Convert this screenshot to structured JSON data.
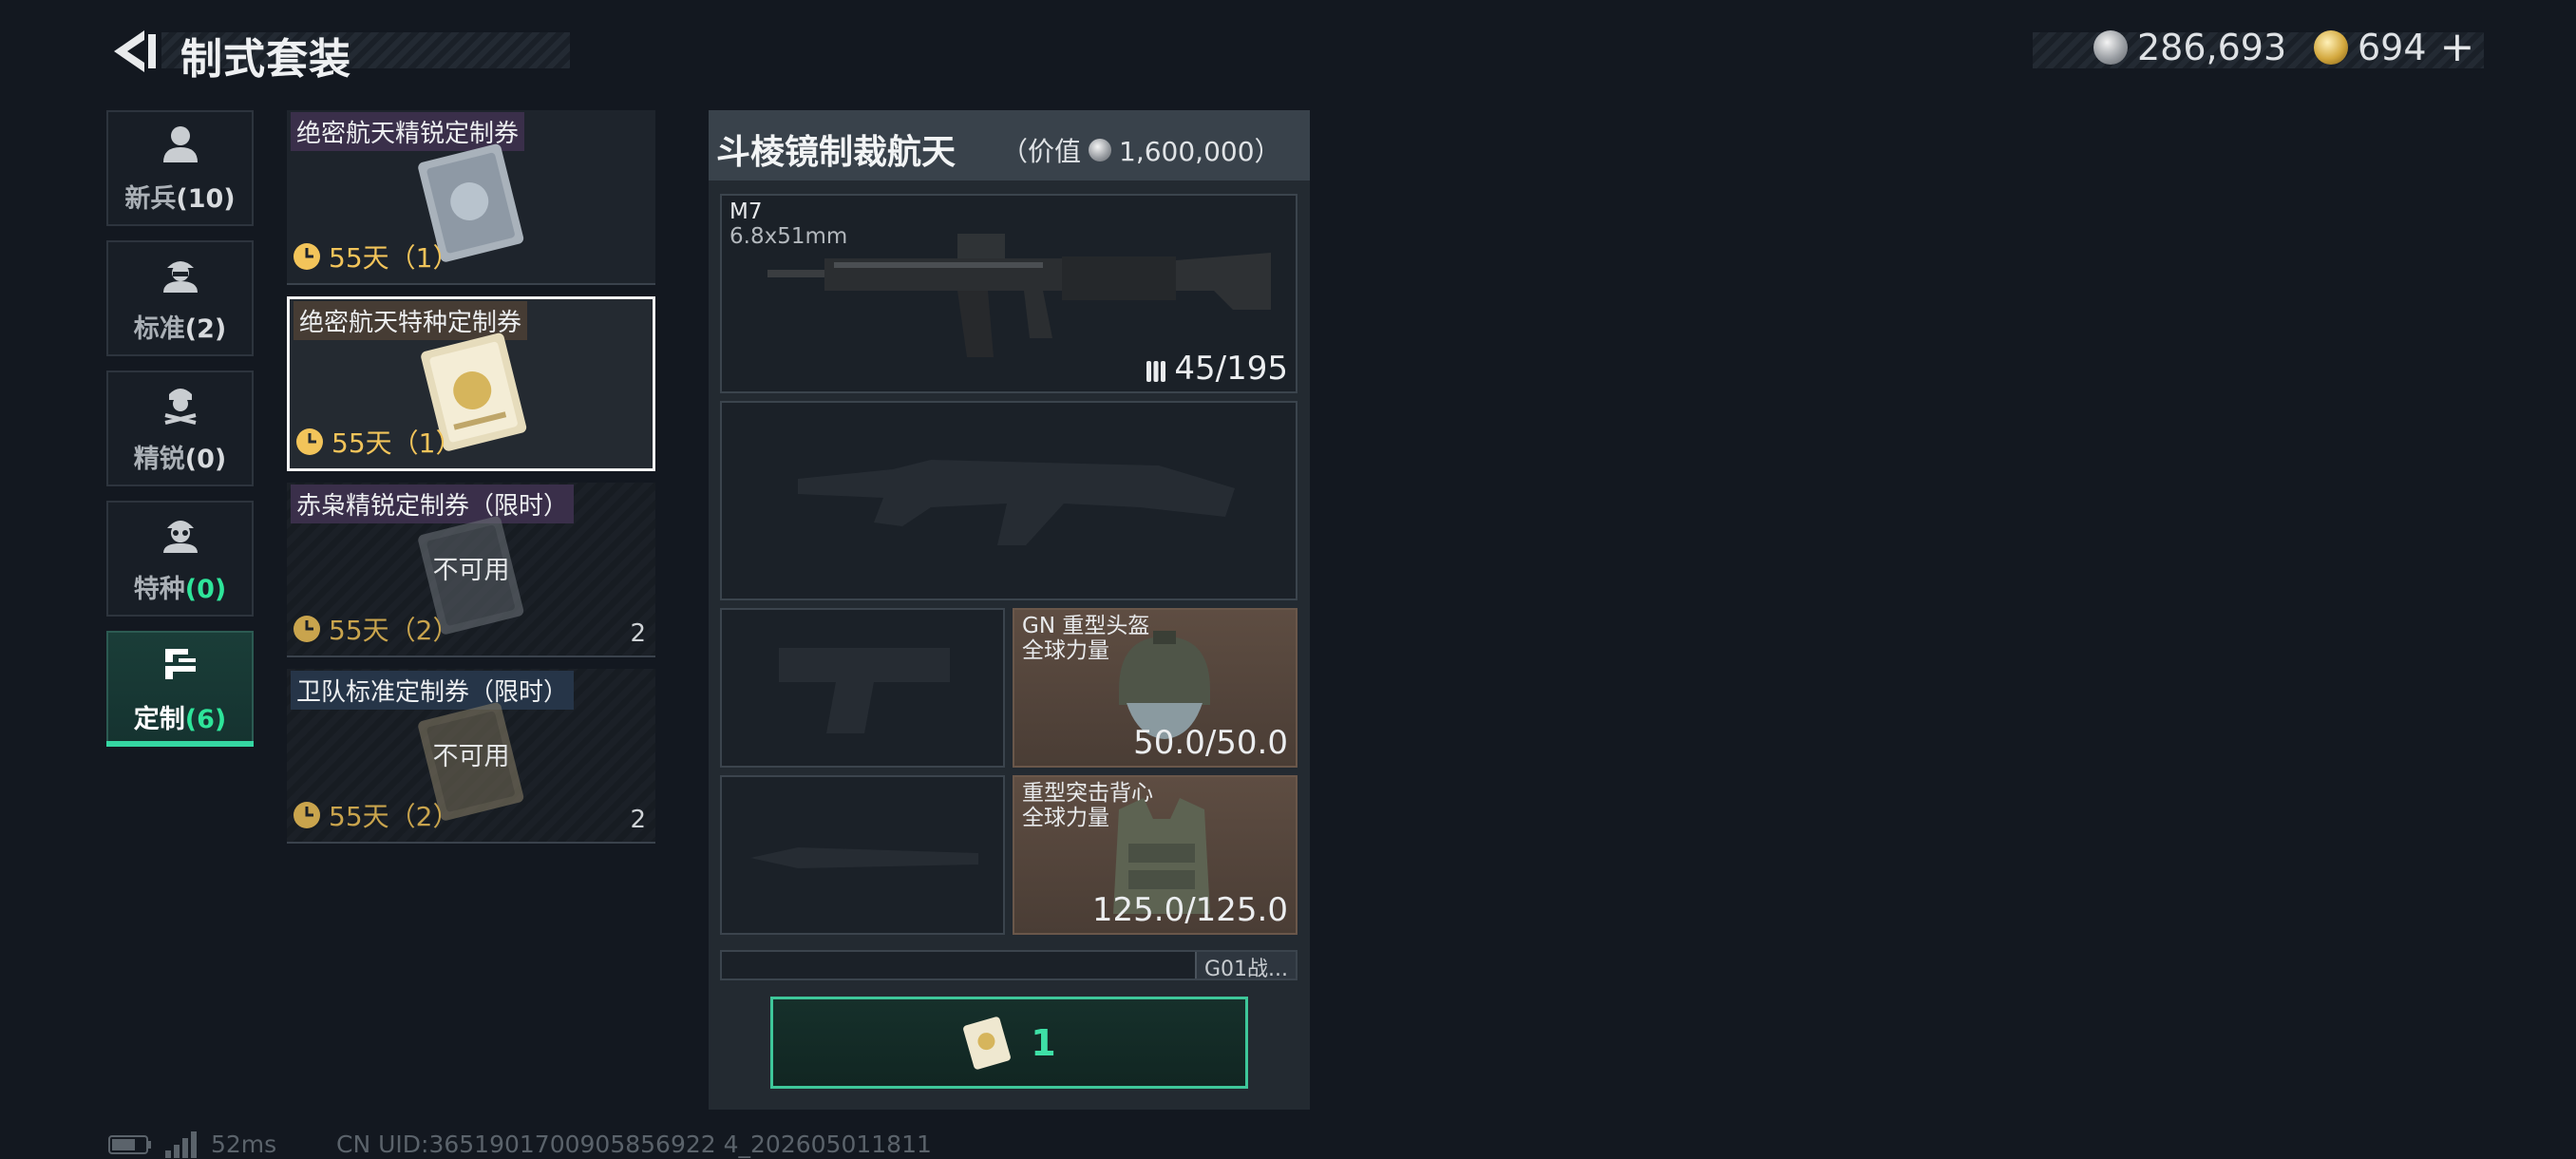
{
  "header": {
    "title": "制式套装",
    "currency_silver": "286,693",
    "currency_gold": "694",
    "plus_label": "+"
  },
  "categories": [
    {
      "label": "新兵",
      "count": "(10)"
    },
    {
      "label": "标准",
      "count": "(2)"
    },
    {
      "label": "精锐",
      "count": "(0)"
    },
    {
      "label": "特种",
      "count": "(0)"
    },
    {
      "label": "定制",
      "count": "(6)"
    }
  ],
  "coupons": [
    {
      "title": "绝密航天精锐定制券",
      "time": "55天（1）",
      "status": "",
      "qty": ""
    },
    {
      "title": "绝密航天特种定制券",
      "time": "55天（1）",
      "status": "",
      "qty": ""
    },
    {
      "title": "赤枭精锐定制券（限时）",
      "time": "55天（2）",
      "status": "不可用",
      "qty": "2"
    },
    {
      "title": "卫队标准定制券（限时）",
      "time": "55天（2）",
      "status": "不可用",
      "qty": "2"
    }
  ],
  "loadout": {
    "name": "斗棱镜制裁航天",
    "value_label": "（价值",
    "value": "1,600,000）",
    "primary_weapon": {
      "name": "M7",
      "caliber": "6.8x51mm",
      "ammo": "45/195"
    },
    "helmet": {
      "name": "GN 重型头盔",
      "brand": "全球力量",
      "durability": "50.0/50.0"
    },
    "armor": {
      "name": "重型突击背心",
      "brand": "全球力量",
      "durability": "125.0/125.0"
    },
    "bottom_tag": "G01战...",
    "confirm_count": "1"
  },
  "footer": {
    "ping": "52ms",
    "uid": "CN UID:3651901700905856922 4_202605011811"
  },
  "colors": {
    "accent_green": "#2ee59a",
    "gold": "#f2c45a",
    "background": "#131820"
  },
  "icons": [
    "back-arrow-icon",
    "silver-coin-icon",
    "gold-coin-icon",
    "recruit-icon",
    "standard-icon",
    "elite-icon",
    "special-icon",
    "custom-icon",
    "clock-icon",
    "ammo-icon",
    "battery-icon",
    "signal-icon"
  ]
}
